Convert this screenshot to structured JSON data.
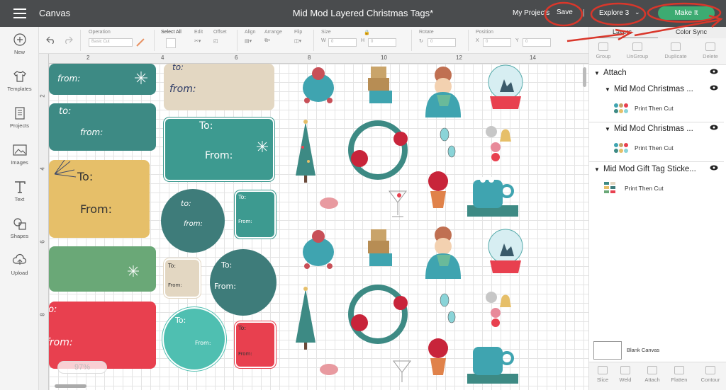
{
  "header": {
    "app_name": "Canvas",
    "document_title": "Mid Mod Layered Christmas Tags*",
    "my_projects": "My Projects",
    "save": "Save",
    "separator": "|",
    "machine": "Explore 3",
    "make_it": "Make It"
  },
  "left_tools": [
    {
      "label": "New",
      "icon": "plus-circle-icon"
    },
    {
      "label": "Templates",
      "icon": "shirt-icon"
    },
    {
      "label": "Projects",
      "icon": "projects-icon"
    },
    {
      "label": "Images",
      "icon": "image-icon"
    },
    {
      "label": "Text",
      "icon": "text-icon"
    },
    {
      "label": "Shapes",
      "icon": "shapes-icon"
    },
    {
      "label": "Upload",
      "icon": "upload-icon"
    }
  ],
  "toolbar": {
    "operation_label": "Operation",
    "operation_value": "Basic Cut",
    "select_all": "Select All",
    "edit": "Edit",
    "offset": "Offset",
    "align": "Align",
    "arrange": "Arrange",
    "flip": "Flip",
    "size": "Size",
    "w": "W",
    "h": "H",
    "rotate": "Rotate",
    "position": "Position",
    "x": "X",
    "y": "Y",
    "zero": "0"
  },
  "rulers": {
    "top": [
      "2",
      "4",
      "6",
      "8",
      "10",
      "12",
      "14"
    ],
    "left": [
      "2",
      "4",
      "6",
      "8"
    ]
  },
  "canvas": {
    "zoom": "97%",
    "tags": {
      "to": "to:",
      "from": "from:",
      "To": "To:",
      "From": "From:",
      "from_caps": "From:"
    }
  },
  "layers_panel": {
    "tab_layers": "Layers",
    "tab_color_sync": "Color Sync",
    "tools": [
      "Group",
      "UnGroup",
      "Duplicate",
      "Delete"
    ],
    "attach_group": "Attach",
    "items": [
      {
        "name": "Mid Mod Christmas ...",
        "sub": "Print Then Cut"
      },
      {
        "name": "Mid Mod Christmas ...",
        "sub": "Print Then Cut"
      },
      {
        "name": "Mid Mod Gift Tag Sticke...",
        "sub": "Print Then Cut"
      }
    ],
    "blank_canvas": "Blank Canvas",
    "bottom_tools": [
      "Slice",
      "Weld",
      "Attach",
      "Flatten",
      "Contour"
    ]
  },
  "colors": {
    "header_bg": "#4a4c4e",
    "make_it_green": "#3dab72",
    "annotation_red": "#d9372b",
    "teal": "#3d8a84",
    "dark_teal": "#3e7c7a",
    "mustard": "#e6bf69",
    "green": "#6aa877",
    "red": "#e8404f",
    "beige": "#e3d7c2",
    "aqua": "#4fbfb1"
  }
}
